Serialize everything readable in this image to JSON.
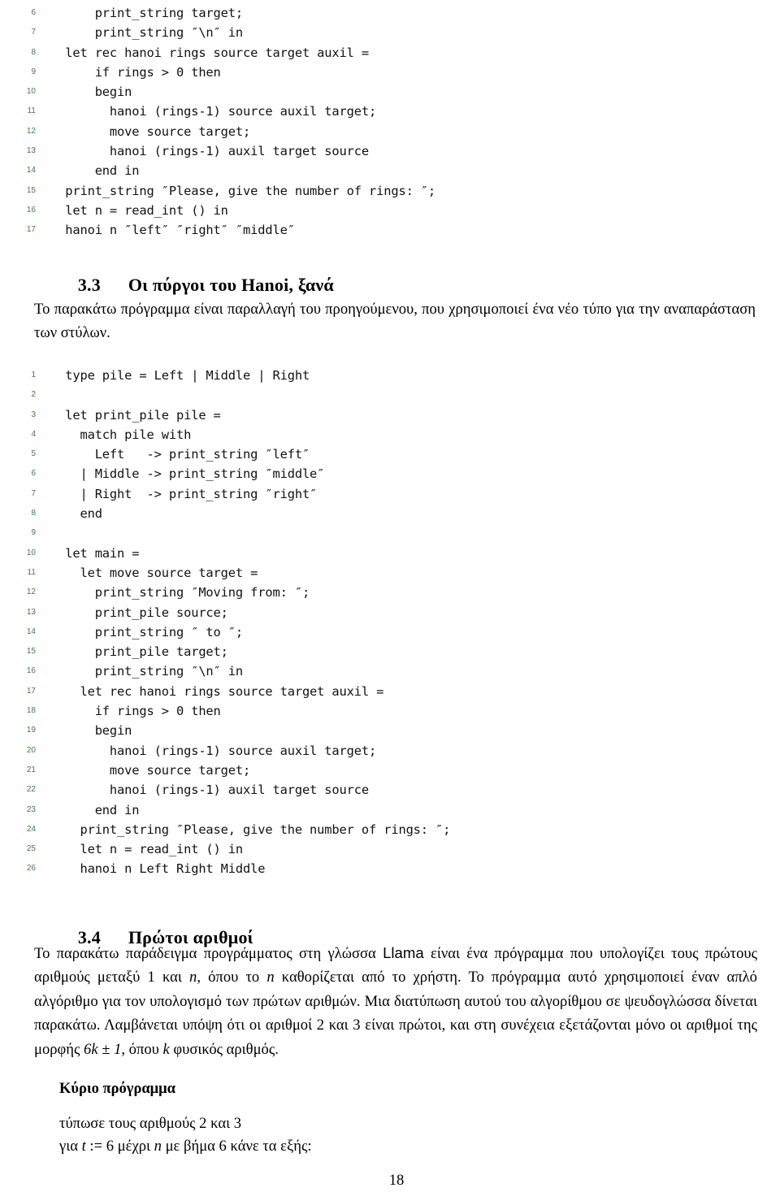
{
  "document": {
    "page_number": "18",
    "language": "el"
  },
  "code_block_1": {
    "name": "hanoi-string-version",
    "lines": [
      {
        "n": "6",
        "text": "      print_string target;"
      },
      {
        "n": "7",
        "text": "      print_string ″\\n″ in"
      },
      {
        "n": "8",
        "text": "  let rec hanoi rings source target auxil ="
      },
      {
        "n": "9",
        "text": "      if rings > 0 then"
      },
      {
        "n": "10",
        "text": "      begin"
      },
      {
        "n": "11",
        "text": "        hanoi (rings-1) source auxil target;"
      },
      {
        "n": "12",
        "text": "        move source target;"
      },
      {
        "n": "13",
        "text": "        hanoi (rings-1) auxil target source"
      },
      {
        "n": "14",
        "text": "      end in"
      },
      {
        "n": "15",
        "text": "  print_string ″Please, give the number of rings: ″;"
      },
      {
        "n": "16",
        "text": "  let n = read_int () in"
      },
      {
        "n": "17",
        "text": "  hanoi n ″left″ ″right″ ″middle″"
      }
    ]
  },
  "section_3_3": {
    "number": "3.3",
    "title": "Οι πύργοι του Hanoi, ξανά",
    "paragraph": "Το παρακάτω πρόγραμμα είναι παραλλαγή του προηγούμενου, που χρησιμοποιεί ένα νέο τύπο για την αναπαράσταση των στύλων."
  },
  "code_block_2": {
    "name": "hanoi-pile-type-version",
    "lines": [
      {
        "n": "1",
        "text": "  type pile = Left | Middle | Right"
      },
      {
        "n": "2",
        "text": ""
      },
      {
        "n": "3",
        "text": "  let print_pile pile ="
      },
      {
        "n": "4",
        "text": "    match pile with"
      },
      {
        "n": "5",
        "text": "      Left   -> print_string ″left″"
      },
      {
        "n": "6",
        "text": "    | Middle -> print_string ″middle″"
      },
      {
        "n": "7",
        "text": "    | Right  -> print_string ″right″"
      },
      {
        "n": "8",
        "text": "    end"
      },
      {
        "n": "9",
        "text": ""
      },
      {
        "n": "10",
        "text": "  let main ="
      },
      {
        "n": "11",
        "text": "    let move source target ="
      },
      {
        "n": "12",
        "text": "      print_string ″Moving from: ″;"
      },
      {
        "n": "13",
        "text": "      print_pile source;"
      },
      {
        "n": "14",
        "text": "      print_string ″ to ″;"
      },
      {
        "n": "15",
        "text": "      print_pile target;"
      },
      {
        "n": "16",
        "text": "      print_string ″\\n″ in"
      },
      {
        "n": "17",
        "text": "    let rec hanoi rings source target auxil ="
      },
      {
        "n": "18",
        "text": "      if rings > 0 then"
      },
      {
        "n": "19",
        "text": "      begin"
      },
      {
        "n": "20",
        "text": "        hanoi (rings-1) source auxil target;"
      },
      {
        "n": "21",
        "text": "        move source target;"
      },
      {
        "n": "22",
        "text": "        hanoi (rings-1) auxil target source"
      },
      {
        "n": "23",
        "text": "      end in"
      },
      {
        "n": "24",
        "text": "    print_string ″Please, give the number of rings: ″;"
      },
      {
        "n": "25",
        "text": "    let n = read_int () in"
      },
      {
        "n": "26",
        "text": "    hanoi n Left Right Middle"
      }
    ]
  },
  "section_3_4": {
    "number": "3.4",
    "title": "Πρώτοι αριθμοί",
    "paragraph_parts": {
      "p1": "Το παρακάτω παράδειγμα προγράμματος στη γλώσσα ",
      "lang_name": "Llama",
      "p2": " είναι ένα πρόγραμμα που υπολογίζει τους πρώτους αριθμούς μεταξύ 1 και ",
      "n1": "n",
      "p3": ", όπου το ",
      "n2": "n",
      "p4": " καθορίζεται από το χρήστη. Το πρόγραμμα αυτό χρησιμοποιεί έναν απλό αλγόριθμο για τον υπολογισμό των πρώτων αριθμών. Μια διατύπωση αυτού του αλγορίθμου σε ψευδογλώσσα δίνεται παρακάτω. Λαμβάνεται υπόψη ότι οι αριθμοί 2 και 3 είναι πρώτοι, και στη συνέχεια εξετάζονται μόνο οι αριθμοί της μορφής ",
      "formula": "6k ± 1",
      "p5": ", όπου ",
      "k": "k",
      "p6": " φυσικός αριθμός."
    }
  },
  "pseudocode": {
    "heading": "Κύριο πρόγραμμα",
    "line1": "τύπωσε τους αριθμούς 2 και 3",
    "line2_a": "για ",
    "line2_t": "t",
    "line2_b": " := 6 μέχρι ",
    "line2_n": "n",
    "line2_c": " με βήμα 6 κάνε τα εξής:"
  },
  "colors": {
    "lineno": "#3f7b3f",
    "code_text": "#111111",
    "body_text": "#000000",
    "background": "#ffffff"
  }
}
